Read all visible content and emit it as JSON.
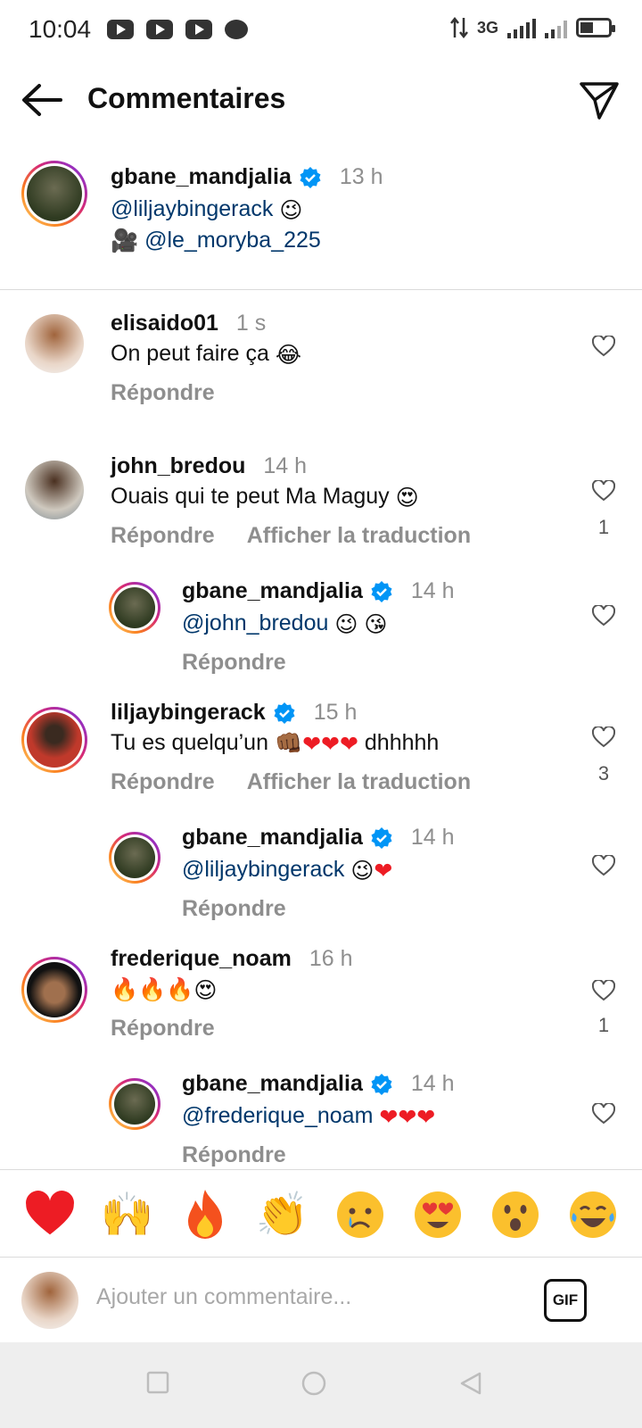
{
  "status_bar": {
    "time": "10:04",
    "network": "3G"
  },
  "header": {
    "title": "Commentaires"
  },
  "caption": {
    "user": "gbane_mandjalia",
    "time": "13 h",
    "line1": "@liljaybingerack",
    "line2": "@le_moryba_225"
  },
  "comments": [
    {
      "user": "elisaido01",
      "time": "1 s",
      "text": "On peut faire ça",
      "reply": "Répondre",
      "translate": "",
      "likes": ""
    },
    {
      "user": "john_bredou",
      "time": "14 h",
      "text": "Ouais qui te peut Ma Maguy",
      "reply": "Répondre",
      "translate": "Afficher la traduction",
      "likes": "1"
    },
    {
      "user": "gbane_mandjalia",
      "time": "14 h",
      "text": "@john_bredou",
      "reply": "Répondre"
    },
    {
      "user": "liljaybingerack",
      "time": "15 h",
      "text": "Tu es quelqu’un",
      "text_after": "dhhhhh",
      "reply": "Répondre",
      "translate": "Afficher la traduction",
      "likes": "3"
    },
    {
      "user": "gbane_mandjalia",
      "time": "14 h",
      "text": "@liljaybingerack",
      "reply": "Répondre"
    },
    {
      "user": "frederique_noam",
      "time": "16 h",
      "text": "",
      "reply": "Répondre",
      "likes": "1"
    },
    {
      "user": "gbane_mandjalia",
      "time": "14 h",
      "text": "@frederique_noam",
      "reply": "Répondre"
    }
  ],
  "reactions": [
    "red-heart",
    "raising-hands",
    "fire",
    "clapping-hands",
    "crying-face",
    "heart-eyes",
    "astonished-face",
    "tears-of-joy"
  ],
  "composer": {
    "placeholder": "Ajouter un commentaire...",
    "gif_label": "GIF"
  },
  "colors": {
    "verified": "#0095f6",
    "mention": "#00376b",
    "muted": "#8e8e8e",
    "heart": "#ed1c24"
  }
}
